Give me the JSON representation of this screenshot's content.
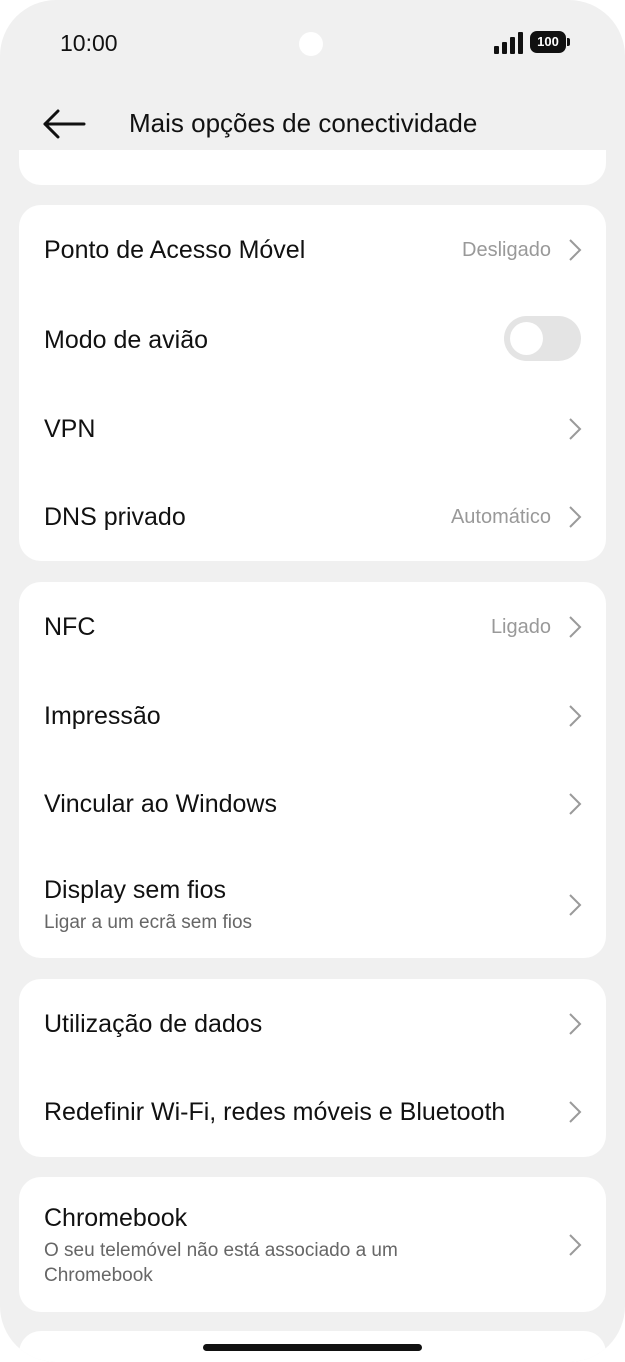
{
  "status_bar": {
    "time": "10:00",
    "battery_level": "100"
  },
  "header": {
    "back_icon": "arrow-left-icon",
    "title": "Mais opções de conectividade"
  },
  "group1": {
    "hotspot": {
      "title": "Ponto de Acesso Móvel",
      "value": "Desligado"
    },
    "airplane": {
      "title": "Modo de avião",
      "toggle_on": false
    },
    "vpn": {
      "title": "VPN"
    },
    "private_dns": {
      "title": "DNS privado",
      "value": "Automático"
    }
  },
  "group2": {
    "nfc": {
      "title": "NFC",
      "value": "Ligado"
    },
    "printing": {
      "title": "Impressão"
    },
    "link_windows": {
      "title": "Vincular ao Windows"
    },
    "wireless_display": {
      "title": "Display sem fios",
      "subtitle": "Ligar a um ecrã sem fios"
    }
  },
  "group3": {
    "data_usage": {
      "title": "Utilização de dados"
    },
    "reset_network": {
      "title": "Redefinir Wi-Fi, redes móveis e Bluetooth"
    }
  },
  "group4": {
    "chromebook": {
      "title": "Chromebook",
      "subtitle_line1": "O seu telemóvel não está associado a um",
      "subtitle_line2": "Chromebook"
    }
  },
  "icons": {
    "chevron": "chevron-right-icon"
  },
  "colors": {
    "background": "#f0f0f0",
    "card": "#ffffff",
    "secondary_text": "#999999",
    "toggle_off": "#e4e4e4"
  }
}
